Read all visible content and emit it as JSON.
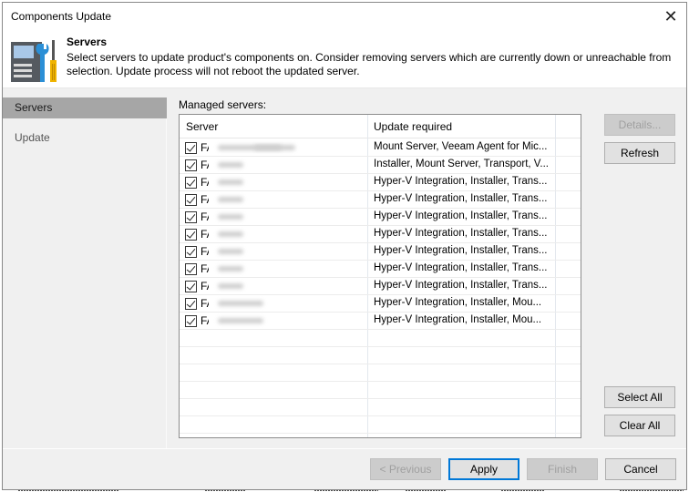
{
  "window": {
    "title": "Components Update",
    "close_icon": "close-icon"
  },
  "header": {
    "title": "Servers",
    "description": "Select servers to update product's components on. Consider removing servers which are currently down or unreachable from selection. Update process will not reboot the updated server.",
    "icon": "server-tools-icon"
  },
  "sidebar": {
    "items": [
      {
        "label": "Servers",
        "active": true
      },
      {
        "label": "Update",
        "active": false
      }
    ]
  },
  "main": {
    "list_label": "Managed servers:",
    "columns": [
      "Server",
      "Update required"
    ],
    "rows": [
      {
        "checked": true,
        "server": "FA",
        "update": "Mount Server, Veeam Agent for Mic..."
      },
      {
        "checked": true,
        "server": "FA",
        "update": "Installer, Mount Server, Transport, V..."
      },
      {
        "checked": true,
        "server": "FA",
        "update": "Hyper-V Integration, Installer, Trans..."
      },
      {
        "checked": true,
        "server": "FA",
        "update": "Hyper-V Integration, Installer, Trans..."
      },
      {
        "checked": true,
        "server": "FA",
        "update": "Hyper-V Integration, Installer, Trans..."
      },
      {
        "checked": true,
        "server": "FA",
        "update": "Hyper-V Integration, Installer, Trans..."
      },
      {
        "checked": true,
        "server": "FA",
        "update": "Hyper-V Integration, Installer, Trans..."
      },
      {
        "checked": true,
        "server": "FA",
        "update": "Hyper-V Integration, Installer, Trans..."
      },
      {
        "checked": true,
        "server": "FA",
        "update": "Hyper-V Integration, Installer, Trans..."
      },
      {
        "checked": true,
        "server": "FA",
        "update": "Hyper-V Integration, Installer, Mou..."
      },
      {
        "checked": true,
        "server": "FA",
        "update": "Hyper-V Integration, Installer, Mou..."
      }
    ],
    "side_buttons": {
      "details": "Details...",
      "refresh": "Refresh",
      "select_all": "Select All",
      "clear_all": "Clear All"
    }
  },
  "footer": {
    "previous": "< Previous",
    "apply": "Apply",
    "finish": "Finish",
    "cancel": "Cancel"
  },
  "colors": {
    "accent": "#0078d7",
    "nav_active_bg": "#a6a6a6",
    "dialog_bg": "#f0f0f0"
  }
}
